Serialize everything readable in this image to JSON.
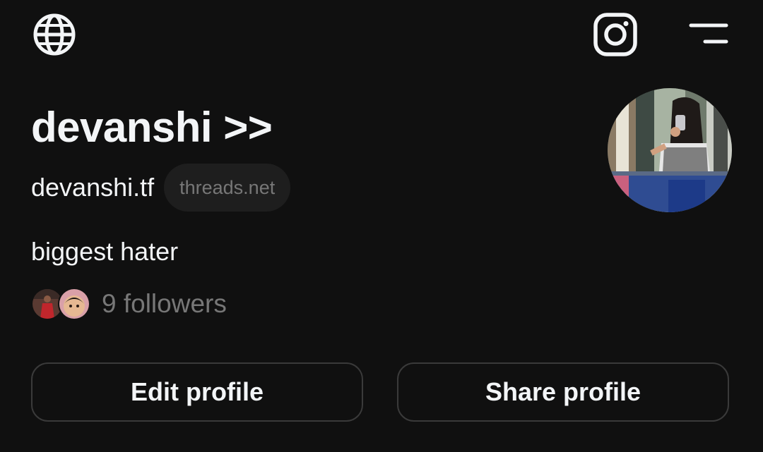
{
  "header": {
    "left_icon": "globe-icon",
    "right_icons": [
      "instagram-icon",
      "menu-icon"
    ]
  },
  "profile": {
    "display_name": "devanshi >>",
    "username": "devanshi.tf",
    "domain_chip": "threads.net",
    "bio": "biggest hater",
    "followers_text": "9 followers",
    "avatar_icon": "profile-photo"
  },
  "actions": {
    "edit_label": "Edit profile",
    "share_label": "Share profile"
  },
  "colors": {
    "background": "#101010",
    "primary_text": "#f3f5f7",
    "secondary_text": "#777777",
    "chip_bg": "#1e1e1e",
    "button_border": "#3a3a3a"
  }
}
